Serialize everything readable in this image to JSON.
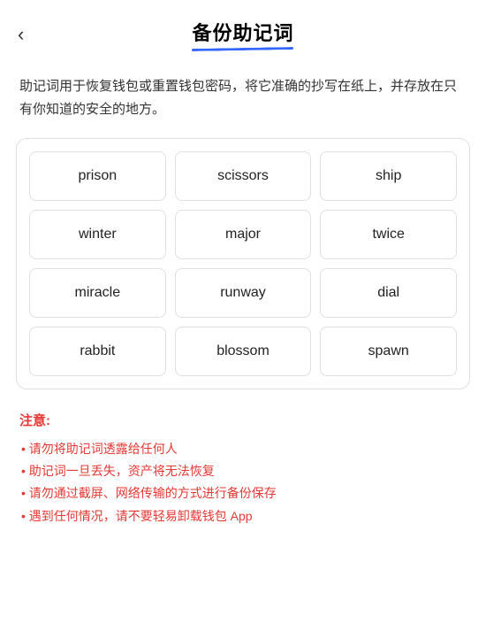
{
  "header": {
    "back_label": "‹",
    "title": "备份助记词"
  },
  "description": "助记词用于恢复钱包或重置钱包密码，将它准确的抄写在纸上，并存放在只有你知道的安全的地方。",
  "mnemonic_words": [
    "prison",
    "scissors",
    "ship",
    "winter",
    "major",
    "twice",
    "miracle",
    "runway",
    "dial",
    "rabbit",
    "blossom",
    "spawn"
  ],
  "notice": {
    "title": "注意:",
    "items": [
      "• 请勿将助记词透露给任何人",
      "• 助记词一旦丢失，资产将无法恢复",
      "• 请勿通过截屏、网络传输的方式进行备份保存",
      "• 遇到任何情况，请不要轻易卸载钱包 App"
    ]
  }
}
